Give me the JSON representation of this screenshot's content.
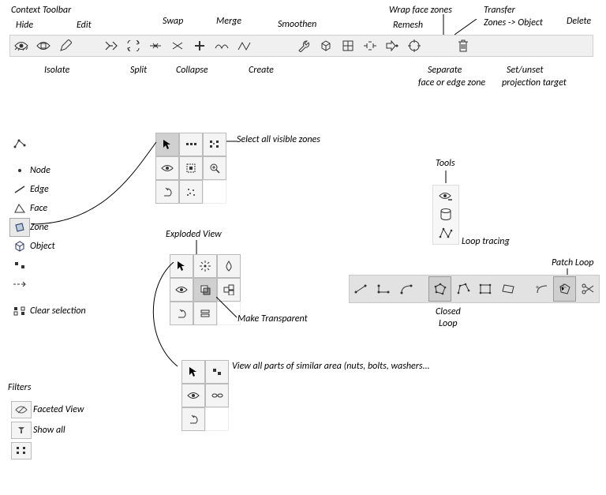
{
  "header": {
    "context_toolbar": "Context Toolbar",
    "hide": "Hide",
    "edit": "Edit",
    "isolate": "Isolate",
    "swap": "Swap",
    "merge": "Merge",
    "smoothen": "Smoothen",
    "split": "Split",
    "collapse": "Collapse",
    "create": "Create",
    "wrap_face_zones": "Wrap face zones",
    "remesh": "Remesh",
    "transfer_zones_object": "Transfer\nZones -> Object",
    "transfer_line1": "Transfer",
    "transfer_line2": "Zones -> Object",
    "delete": "Delete",
    "separate_line1": "Separate",
    "separate_line2": "face or edge zone",
    "set_unset_line1": "Set/unset",
    "set_unset_line2": "projection target"
  },
  "annotations": {
    "select_all_visible": "Select all visible zones",
    "exploded_view": "Exploded View",
    "make_transparent": "Make Transparent",
    "view_similar_area": "View all parts of similar area (nuts, bolts, washers...",
    "tools": "Tools",
    "loop_tracing": "Loop tracing",
    "patch_loop": "Patch Loop",
    "closed": "Closed",
    "loop": "Loop"
  },
  "selection": {
    "node": "Node",
    "edge": "Edge",
    "face": "Face",
    "zone": "Zone",
    "object": "Object",
    "clear_selection": "Clear selection"
  },
  "filters": {
    "title": "Filters",
    "faceted_view": "Faceted View",
    "show_all": "Show all"
  }
}
